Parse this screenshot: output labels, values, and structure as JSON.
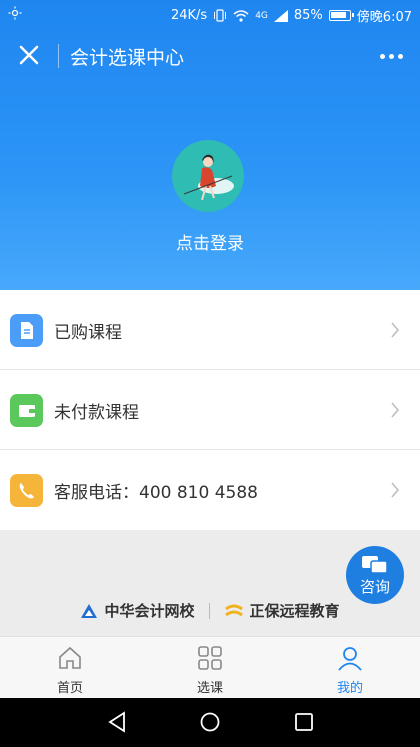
{
  "status_bar": {
    "speed": "24K/s",
    "network": "4G",
    "battery": "85%",
    "time": "傍晚6:07"
  },
  "title_bar": {
    "title": "会计选课中心"
  },
  "profile": {
    "login_text": "点击登录"
  },
  "menu": [
    {
      "label": "已购课程",
      "color": "#4b9df7"
    },
    {
      "label": "未付款课程",
      "color": "#5ac85a"
    },
    {
      "label": "客服电话：400 810 4588",
      "color": "#f5b53a"
    }
  ],
  "consult": {
    "label": "咨询"
  },
  "brands": {
    "brand1": "中华会计网校",
    "brand2": "正保远程教育"
  },
  "tabs": [
    {
      "label": "首页"
    },
    {
      "label": "选课"
    },
    {
      "label": "我的",
      "active": true
    }
  ],
  "colors": {
    "primary": "#1f86f0",
    "accent_consult": "#1e7fe0"
  }
}
